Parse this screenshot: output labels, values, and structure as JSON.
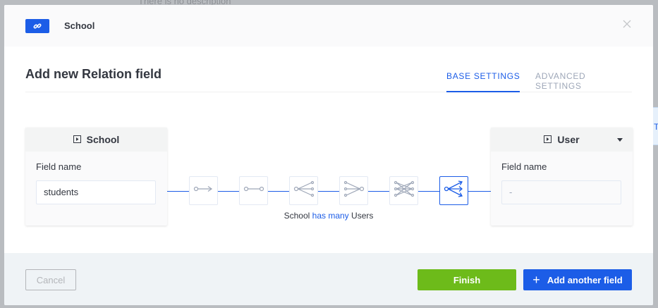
{
  "background": {
    "description_text": "There is no description",
    "edge_tab_letter": "T"
  },
  "header": {
    "icon": "link-icon",
    "title": "School"
  },
  "modal": {
    "title": "Add new Relation field",
    "tabs": [
      {
        "label": "BASE SETTINGS",
        "active": true
      },
      {
        "label": "ADVANCED SETTINGS",
        "active": false
      }
    ]
  },
  "left_model": {
    "name": "School",
    "field_label": "Field name",
    "field_value": "students"
  },
  "right_model": {
    "name": "User",
    "field_label": "Field name",
    "field_value": "-"
  },
  "relations": [
    {
      "name": "one-way",
      "icon": "one-way-relation-icon",
      "active": false
    },
    {
      "name": "one-to-one",
      "icon": "one-to-one-relation-icon",
      "active": false
    },
    {
      "name": "one-to-many",
      "icon": "one-to-many-relation-icon",
      "active": false
    },
    {
      "name": "many-to-one",
      "icon": "many-to-one-relation-icon",
      "active": false
    },
    {
      "name": "many-to-many",
      "icon": "many-to-many-relation-icon",
      "active": false
    },
    {
      "name": "many-way",
      "icon": "many-way-relation-icon",
      "active": true
    }
  ],
  "relation_caption": {
    "left": "School",
    "verb": "has many",
    "right": "Users"
  },
  "footer": {
    "cancel_label": "Cancel",
    "finish_label": "Finish",
    "add_label": "Add another field"
  },
  "colors": {
    "accent": "#1c5de7",
    "finish": "#6dbb1a",
    "footer_bg": "#eff3f6"
  }
}
